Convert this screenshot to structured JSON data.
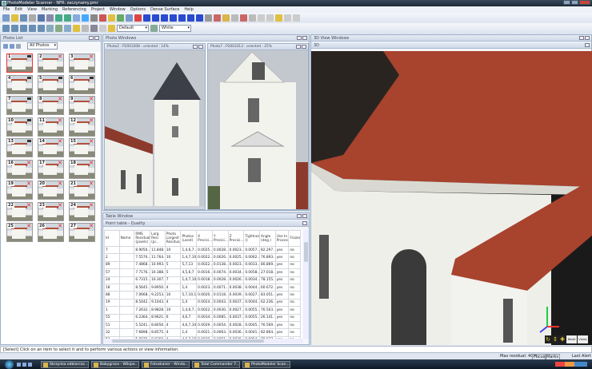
{
  "app": {
    "title": "PhotoModeler Scanner - NFR: zaczynamy.pmr"
  },
  "menu": [
    "File",
    "Edit",
    "View",
    "Marking",
    "Referencing",
    "Project",
    "Window",
    "Options",
    "Dense Surface",
    "Help"
  ],
  "toolbar": {
    "style_select": "Default",
    "color_select": "White"
  },
  "photo_list": {
    "title": "Photo List",
    "filter": "All Photos",
    "thumbs": [
      {
        "n": "1",
        "oriented": true,
        "selected": true
      },
      {
        "n": "2",
        "oriented": false
      },
      {
        "n": "3",
        "oriented": false
      },
      {
        "n": "4",
        "oriented": true
      },
      {
        "n": "5",
        "oriented": true
      },
      {
        "n": "6",
        "oriented": true
      },
      {
        "n": "7",
        "oriented": true
      },
      {
        "n": "8",
        "oriented": false
      },
      {
        "n": "9",
        "oriented": false
      },
      {
        "n": "10",
        "oriented": true
      },
      {
        "n": "11",
        "oriented": false
      },
      {
        "n": "12",
        "oriented": false
      },
      {
        "n": "13",
        "oriented": true
      },
      {
        "n": "14",
        "oriented": false
      },
      {
        "n": "15",
        "oriented": false
      },
      {
        "n": "16",
        "oriented": false
      },
      {
        "n": "17",
        "oriented": false
      },
      {
        "n": "18",
        "oriented": false
      },
      {
        "n": "19",
        "oriented": false
      },
      {
        "n": "20",
        "oriented": false
      },
      {
        "n": "21",
        "oriented": false
      },
      {
        "n": "22",
        "oriented": false
      },
      {
        "n": "23",
        "oriented": false
      },
      {
        "n": "24",
        "oriented": false
      },
      {
        "n": "25",
        "oriented": false
      },
      {
        "n": "26",
        "oriented": false
      },
      {
        "n": "27",
        "oriented": false
      }
    ]
  },
  "photo_windows": {
    "title": "Photo Windows",
    "photo_a": "Photo2 : P2003308 : oriented : 14%",
    "photo_b": "Photo7 : P2003313 : oriented : 25%"
  },
  "table_window": {
    "title": "Table Window",
    "subtitle": "Point table - Quality",
    "columns": [
      "Id",
      "Name",
      "RMS Residual (pixels)",
      "Larg Resi (pi...",
      "Photo Largest Residual",
      "Photos (used)",
      "X Precisi...",
      "Y Precisi...",
      "Z Precisi...",
      "Tightness ()",
      "Angle (deg.)",
      "Use In Process...",
      "Frozen"
    ],
    "rows": [
      [
        "7",
        "",
        "8.9050...",
        "11.848...",
        "10",
        "1,4,6,7...",
        "0.0025...",
        "0.0028...",
        "0.0023...",
        "0.0057...",
        "82.297...",
        "yes",
        "no"
      ],
      [
        "2",
        "",
        "7.5570...",
        "11.764...",
        "10",
        "1,4,7,10",
        "0.0022...",
        "0.0026...",
        "0.0025...",
        "0.0062...",
        "76.893...",
        "yes",
        "no"
      ],
      [
        "89",
        "",
        "7.4868...",
        "10.993...",
        "5",
        "5,7,13",
        "0.0022...",
        "0.0138...",
        "0.0023...",
        "0.0033...",
        "80.869...",
        "yes",
        "no"
      ],
      [
        "57",
        "",
        "7.7176...",
        "10.388...",
        "5",
        "4,5,6,7",
        "0.0016...",
        "0.0074...",
        "0.0034...",
        "0.0058...",
        "27.018...",
        "yes",
        "no"
      ],
      [
        "24",
        "",
        "6.7315...",
        "10.307...",
        "7",
        "1,4,7,10",
        "0.0018...",
        "0.0028...",
        "0.0026...",
        "0.0034...",
        "78.155...",
        "yes",
        "no"
      ],
      [
        "18",
        "",
        "8.5645...",
        "9.8950...",
        "4",
        "1,4",
        "0.0023...",
        "0.0071...",
        "0.0038...",
        "0.0044...",
        "60.672...",
        "yes",
        "no"
      ],
      [
        "88",
        "",
        "7.0668...",
        "9.2253...",
        "10",
        "5,7,10,13",
        "0.0020...",
        "0.0118...",
        "0.0039...",
        "0.0027...",
        "83.051...",
        "yes",
        "no"
      ],
      [
        "19",
        "",
        "8.5442...",
        "9.1043...",
        "4",
        "1,4",
        "0.0024...",
        "0.0043...",
        "0.0037...",
        "0.0044...",
        "62.236...",
        "yes",
        "no"
      ],
      [
        "1",
        "",
        "7.2632...",
        "8.9828...",
        "10",
        "1,4,6,7...",
        "0.0022...",
        "0.0030...",
        "0.0027...",
        "0.0055...",
        "76.503...",
        "yes",
        "no"
      ],
      [
        "55",
        "",
        "6.2364...",
        "8.9621...",
        "6",
        "4,6,7",
        "0.0034...",
        "0.0085...",
        "0.0037...",
        "0.0055...",
        "26.141...",
        "yes",
        "no"
      ],
      [
        "51",
        "",
        "5.5241...",
        "8.8056...",
        "4",
        "4,6,7,10",
        "0.0029...",
        "0.0054...",
        "0.0028...",
        "0.0045...",
        "76.569...",
        "yes",
        "no"
      ],
      [
        "32",
        "",
        "7.6898...",
        "8.8575...",
        "4",
        "1,4",
        "0.0021...",
        "0.0063...",
        "0.0036...",
        "0.0041...",
        "82.864...",
        "yes",
        "no"
      ],
      [
        "52",
        "",
        "5.8079...",
        "8.8360...",
        "4",
        "4,6,7,10",
        "0.0029...",
        "0.0051...",
        "0.0028...",
        "0.0054...",
        "78.037...",
        "yes",
        "no"
      ],
      [
        "91",
        "",
        "6.1493...",
        "8.3206...",
        "10",
        "5,7,10,13",
        "0.0015...",
        "0.0140...",
        "0.0019...",
        "0.0035...",
        "81.679...",
        "yes",
        "no"
      ],
      [
        "88",
        "",
        "5.9043...",
        "7.7434...",
        "5",
        "5,7,13",
        "0.0018...",
        "0.0112...",
        "0.0018...",
        "0.0009...",
        "81.782...",
        "yes",
        "no"
      ]
    ]
  },
  "view3d": {
    "title": "3D View Windows",
    "subtitle": "3D",
    "btn_a": "Reset",
    "btn_b": "Views"
  },
  "status": {
    "message": "[Select] Click on an item to select it and to perform various actions or view information.",
    "max_residual": "Max residual: 40.4",
    "mode_a": "Focus",
    "mode_b": "Marks",
    "alert": "Last Alert"
  },
  "taskbar": [
    "Skrzynka odbiorcza ...",
    "Babygraco - Wikipe...",
    "Fotoskaner - Windo...",
    "Total Commander 7...",
    "PhotoModeler Scan..."
  ],
  "colors": {
    "roof": "#a8432e",
    "wall": "#f2f2ee",
    "sky": "#c9ced6",
    "titlebar": "#1d2a38"
  }
}
